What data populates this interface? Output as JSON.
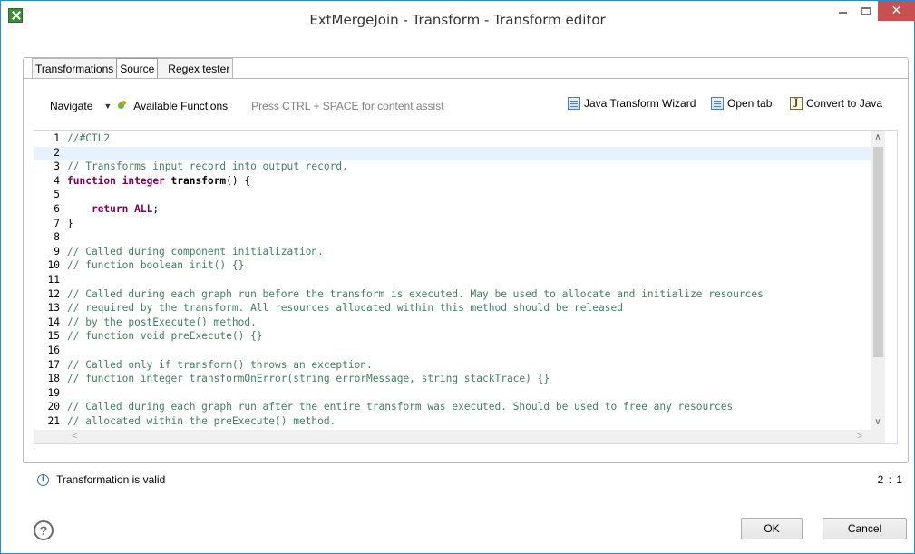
{
  "window": {
    "title": "ExtMergeJoin - Transform - Transform editor",
    "close_glyph": "✕"
  },
  "tabs": [
    {
      "label": "Transformations",
      "active": false
    },
    {
      "label": "Source",
      "active": true
    },
    {
      "label": "Regex tester",
      "active": false
    }
  ],
  "toolbar": {
    "navigate_label": "Navigate",
    "dropdown_glyph": "▼",
    "available_functions_label": "Available Functions",
    "hint": "Press CTRL + SPACE for content assist",
    "java_wizard_label": "Java Transform Wizard",
    "open_tab_label": "Open tab",
    "convert_label": "Convert to Java",
    "java_icon_glyph": "J"
  },
  "editor": {
    "current_line": 2,
    "lines": [
      {
        "n": "1",
        "segments": [
          {
            "t": "//#CTL2",
            "k": "comment"
          }
        ]
      },
      {
        "n": "2",
        "segments": []
      },
      {
        "n": "3",
        "segments": [
          {
            "t": "// Transforms input record into output record.",
            "k": "comment"
          }
        ]
      },
      {
        "n": "4",
        "segments": [
          {
            "t": "function",
            "k": "kw"
          },
          {
            "t": " ",
            "k": "plain"
          },
          {
            "t": "integer",
            "k": "kw"
          },
          {
            "t": " ",
            "k": "plain"
          },
          {
            "t": "transform",
            "k": "fn"
          },
          {
            "t": "() {",
            "k": "plain"
          }
        ]
      },
      {
        "n": "5",
        "segments": []
      },
      {
        "n": "6",
        "segments": [
          {
            "t": "    ",
            "k": "plain"
          },
          {
            "t": "return",
            "k": "kw"
          },
          {
            "t": " ",
            "k": "plain"
          },
          {
            "t": "ALL",
            "k": "kw"
          },
          {
            "t": ";",
            "k": "plain"
          }
        ]
      },
      {
        "n": "7",
        "segments": [
          {
            "t": "}",
            "k": "plain"
          }
        ]
      },
      {
        "n": "8",
        "segments": []
      },
      {
        "n": "9",
        "segments": [
          {
            "t": "// Called during component initialization.",
            "k": "comment"
          }
        ]
      },
      {
        "n": "10",
        "segments": [
          {
            "t": "// function boolean init() {}",
            "k": "comment"
          }
        ]
      },
      {
        "n": "11",
        "segments": []
      },
      {
        "n": "12",
        "segments": [
          {
            "t": "// Called during each graph run before the transform is executed. May be used to allocate and initialize resources",
            "k": "comment"
          }
        ]
      },
      {
        "n": "13",
        "segments": [
          {
            "t": "// required by the transform. All resources allocated within this method should be released",
            "k": "comment"
          }
        ]
      },
      {
        "n": "14",
        "segments": [
          {
            "t": "// by the postExecute() method.",
            "k": "comment"
          }
        ]
      },
      {
        "n": "15",
        "segments": [
          {
            "t": "// function void preExecute() {}",
            "k": "comment"
          }
        ]
      },
      {
        "n": "16",
        "segments": []
      },
      {
        "n": "17",
        "segments": [
          {
            "t": "// Called only if transform() throws an exception.",
            "k": "comment"
          }
        ]
      },
      {
        "n": "18",
        "segments": [
          {
            "t": "// function integer transformOnError(string errorMessage, string stackTrace) {}",
            "k": "comment"
          }
        ]
      },
      {
        "n": "19",
        "segments": []
      },
      {
        "n": "20",
        "segments": [
          {
            "t": "// Called during each graph run after the entire transform was executed. Should be used to free any resources",
            "k": "comment"
          }
        ]
      },
      {
        "n": "21",
        "segments": [
          {
            "t": "// allocated within the preExecute() method.",
            "k": "comment"
          }
        ]
      }
    ],
    "scroll_up_glyph": "∧",
    "scroll_down_glyph": "∨",
    "scroll_left_glyph": "<",
    "scroll_right_glyph": ">"
  },
  "status": {
    "info_glyph": "i",
    "message": "Transformation is valid",
    "cursor_position": "2 : 1"
  },
  "footer": {
    "help_glyph": "?",
    "ok_label": "OK",
    "cancel_label": "Cancel"
  },
  "colors": {
    "close_button": "#c75050",
    "comment": "#3f7f5f",
    "keyword": "#7f0055",
    "current_line": "#e8f2fe",
    "window_border": "#2b8ac9"
  }
}
